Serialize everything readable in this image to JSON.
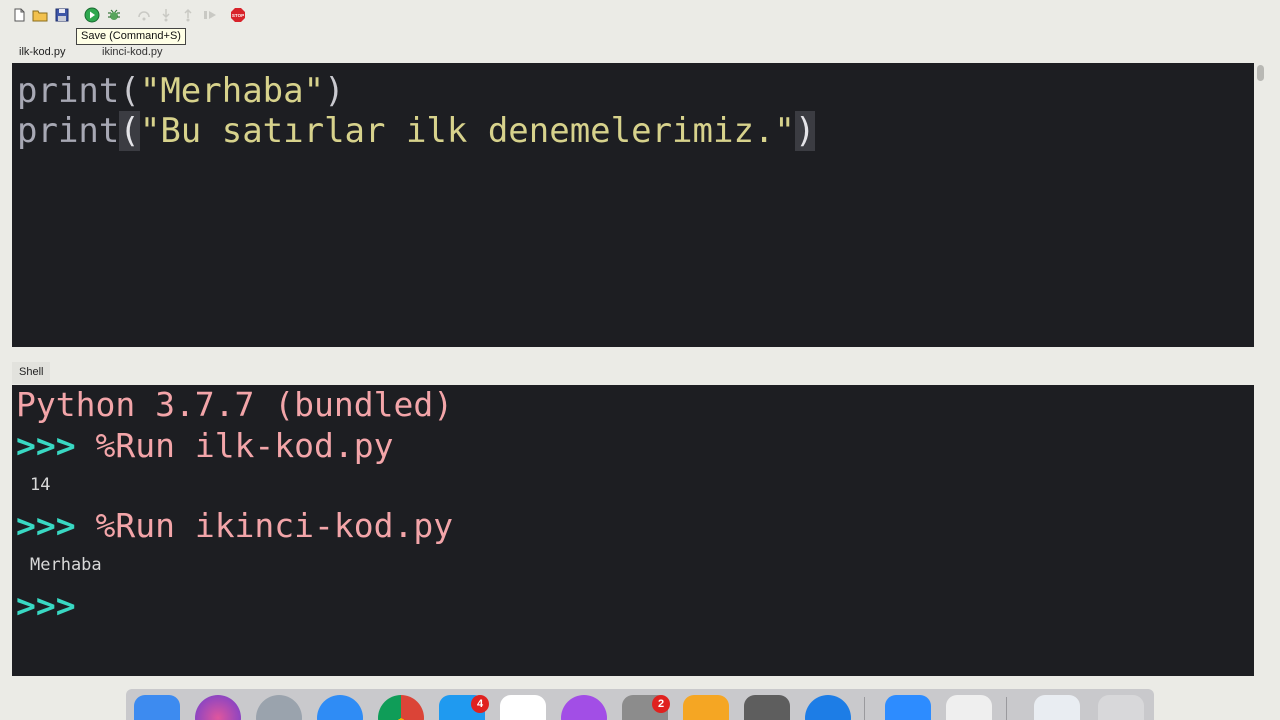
{
  "toolbar": {
    "tooltip": "Save (Command+S)",
    "icons": [
      "new-file-icon",
      "open-folder-icon",
      "save-icon",
      "run-icon",
      "debug-icon",
      "step-over-icon",
      "step-into-icon",
      "step-out-icon",
      "resume-icon",
      "stop-icon"
    ],
    "stop_label": "STOP"
  },
  "tabs": [
    {
      "label": "ilk-kod.py",
      "active": true
    },
    {
      "label": "ikinci-kod.py",
      "active": false
    }
  ],
  "editor": {
    "lines": [
      {
        "fn": "print",
        "open": "(",
        "str": "\"Merhaba\"",
        "close": ")"
      },
      {
        "fn": "print",
        "open": "(",
        "str": "\"Bu satırlar ilk denemelerimiz.\"",
        "close": ")"
      }
    ]
  },
  "shell": {
    "tab_label": "Shell",
    "banner": "Python 3.7.7 (bundled)",
    "prompt": ">>>",
    "entries": [
      {
        "command": "%Run ilk-kod.py",
        "output": "14"
      },
      {
        "command": "%Run ikinci-kod.py",
        "output": "Merhaba"
      }
    ]
  },
  "dock": {
    "badges": {
      "app_store": "4",
      "system_preferences": "2"
    },
    "colors": {
      "finder": "#3d8bf0",
      "siri": "#6b3ed0",
      "launchpad": "#9aa3ad",
      "safari": "#2f8cf5",
      "chrome": "#db4437",
      "app_store": "#1f9af0",
      "music": "#fa3b5c",
      "podcasts": "#a24ee6",
      "system_preferences": "#8c8c8c",
      "pages": "#f5a623",
      "calculator": "#5e5e5e",
      "teamviewer": "#1d7de6",
      "zoom": "#2d8cff",
      "font_book": "#efefef",
      "preview": "#e9edf2",
      "trash": "#d8d8da"
    }
  },
  "colors": {
    "editor_bg": "#1d1e22",
    "chrome_bg": "#ebebe6",
    "string": "#d7d28c",
    "prompt": "#39d8c3",
    "shell_text": "#f3a5a9"
  }
}
